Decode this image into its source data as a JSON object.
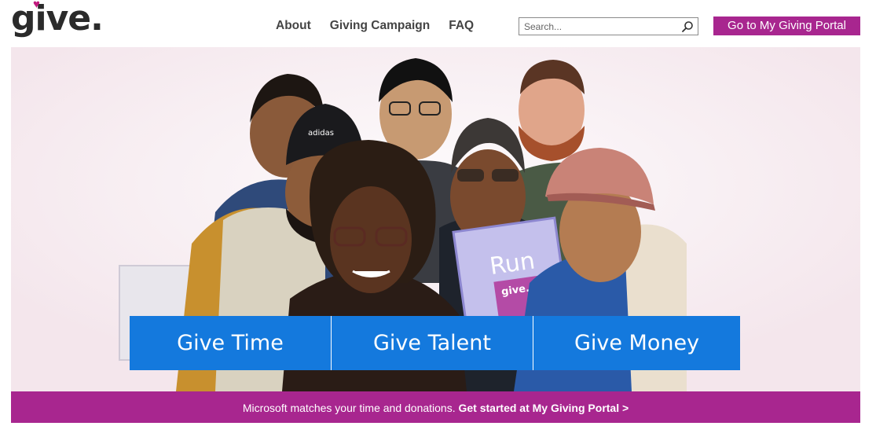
{
  "header": {
    "logo_text": "give.",
    "nav": [
      {
        "label": "About"
      },
      {
        "label": "Giving Campaign"
      },
      {
        "label": "FAQ"
      }
    ],
    "search": {
      "placeholder": "Search...",
      "value": ""
    },
    "portal_button": "Go to My Giving Portal"
  },
  "hero": {
    "sign_text": "Run",
    "card_text": "give.",
    "buttons": [
      {
        "label": "Give Time"
      },
      {
        "label": "Give Talent"
      },
      {
        "label": "Give Money"
      }
    ],
    "cap_text": "adidas"
  },
  "promo": {
    "text": "Microsoft matches your time and donations.",
    "link": "Get started at My Giving Portal >"
  },
  "colors": {
    "brand_magenta": "#a8268f",
    "button_blue": "#1479dd",
    "heart_pink": "#c2197e"
  }
}
